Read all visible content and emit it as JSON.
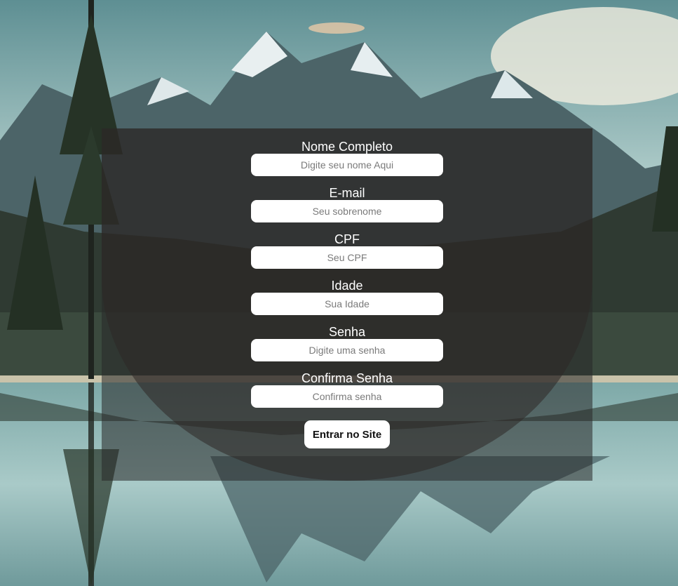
{
  "form": {
    "fields": [
      {
        "label": "Nome Completo",
        "placeholder": "Digite seu nome Aqui",
        "type": "text"
      },
      {
        "label": "E-mail",
        "placeholder": "Seu sobrenome",
        "type": "text"
      },
      {
        "label": "CPF",
        "placeholder": "Seu CPF",
        "type": "text"
      },
      {
        "label": "Idade",
        "placeholder": "Sua Idade",
        "type": "text"
      },
      {
        "label": "Senha",
        "placeholder": "Digite uma senha",
        "type": "password"
      },
      {
        "label": "Confirma Senha",
        "placeholder": "Confirma senha",
        "type": "password"
      }
    ],
    "submit_label": "Entrar no Site"
  },
  "colors": {
    "panel": "#282828",
    "input_background": "#ffffff",
    "label_text": "#ffffff"
  }
}
